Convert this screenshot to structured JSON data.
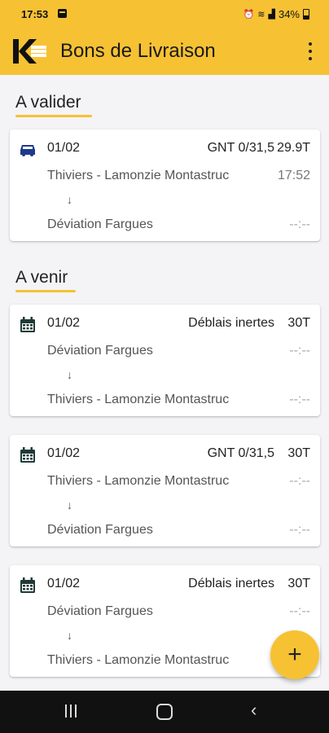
{
  "status_bar": {
    "time": "17:53",
    "battery": "34%"
  },
  "app_bar": {
    "title": "Bons de Livraison"
  },
  "colors": {
    "accent": "#f6c234",
    "icon_dark": "#1f3b37",
    "truck": "#1e3a8a"
  },
  "sections": {
    "to_validate": {
      "title": "A valider"
    },
    "upcoming": {
      "title": "A venir"
    }
  },
  "cards": [
    {
      "icon": "truck-icon",
      "date": "01/02",
      "material": "GNT 0/31,5",
      "weight": "29.9T",
      "from": "Thiviers - Lamonzie Montastruc",
      "from_time": "17:52",
      "arrow": "↓",
      "to": "Déviation Fargues",
      "to_time": "--:--"
    },
    {
      "icon": "calendar-icon",
      "date": "01/02",
      "material": "Déblais inertes",
      "weight": "30T",
      "from": "Déviation Fargues",
      "from_time": "--:--",
      "arrow": "↓",
      "to": "Thiviers - Lamonzie Montastruc",
      "to_time": "--:--"
    },
    {
      "icon": "calendar-icon",
      "date": "01/02",
      "material": "GNT 0/31,5",
      "weight": "30T",
      "from": "Thiviers - Lamonzie Montastruc",
      "from_time": "--:--",
      "arrow": "↓",
      "to": "Déviation Fargues",
      "to_time": "--:--"
    },
    {
      "icon": "calendar-icon",
      "date": "01/02",
      "material": "Déblais inertes",
      "weight": "30T",
      "from": "Déviation Fargues",
      "from_time": "--:--",
      "arrow": "↓",
      "to": "Thiviers - Lamonzie Montastruc",
      "to_time": ""
    }
  ],
  "fab": {
    "label": "+"
  }
}
